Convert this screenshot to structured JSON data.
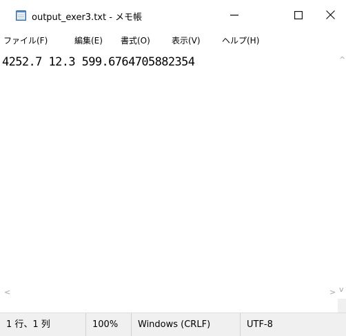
{
  "window": {
    "title": "output_exer3.txt - メモ帳",
    "icon": "notepad-icon",
    "controls": {
      "minimize_icon": "minimize-icon",
      "maximize_icon": "maximize-icon",
      "close_icon": "close-icon"
    }
  },
  "menu": {
    "items": [
      {
        "label": "ファイル(F)"
      },
      {
        "label": "編集(E)"
      },
      {
        "label": "書式(O)"
      },
      {
        "label": "表示(V)"
      },
      {
        "label": "ヘルプ(H)"
      }
    ]
  },
  "editor": {
    "content": "4252.7 12.3 599.6764705882354"
  },
  "scrollbars": {
    "left_arrow": "<",
    "right_arrow": ">",
    "up_arrow": "^",
    "down_arrow": "v"
  },
  "status": {
    "position": "1 行、1 列",
    "zoom": "100%",
    "line_ending": "Windows (CRLF)",
    "encoding": "UTF-8"
  },
  "colors": {
    "background": "#ffffff",
    "statusbar_bg": "#f0f0f0",
    "text": "#000000"
  }
}
